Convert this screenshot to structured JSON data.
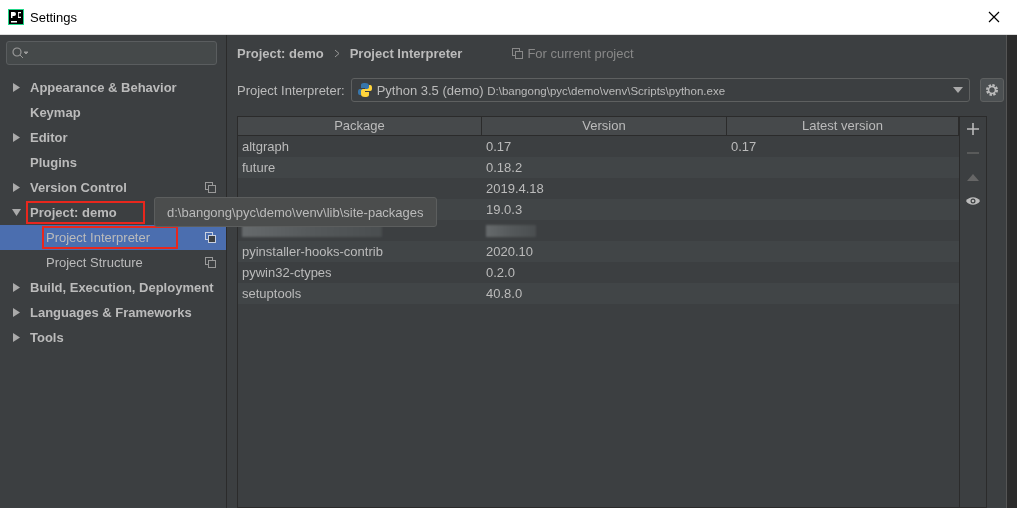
{
  "window": {
    "title": "Settings"
  },
  "sidebar": {
    "items": [
      {
        "label": "Appearance & Behavior",
        "kind": "group",
        "expanded": false,
        "project_scoped": false,
        "annotated": false
      },
      {
        "label": "Keymap",
        "kind": "leaf",
        "project_scoped": false,
        "annotated": false
      },
      {
        "label": "Editor",
        "kind": "group",
        "expanded": false,
        "project_scoped": false,
        "annotated": false
      },
      {
        "label": "Plugins",
        "kind": "leaf",
        "project_scoped": false,
        "annotated": false
      },
      {
        "label": "Version Control",
        "kind": "group",
        "expanded": false,
        "project_scoped": true,
        "annotated": false
      },
      {
        "label": "Project: demo",
        "kind": "group",
        "expanded": true,
        "project_scoped": false,
        "annotated": true,
        "children": [
          {
            "label": "Project Interpreter",
            "selected": true,
            "project_scoped": true,
            "annotated": true
          },
          {
            "label": "Project Structure",
            "selected": false,
            "project_scoped": true,
            "annotated": false
          }
        ]
      },
      {
        "label": "Build, Execution, Deployment",
        "kind": "group",
        "expanded": false,
        "project_scoped": false,
        "annotated": false
      },
      {
        "label": "Languages & Frameworks",
        "kind": "group",
        "expanded": false,
        "project_scoped": false,
        "annotated": false
      },
      {
        "label": "Tools",
        "kind": "group",
        "expanded": false,
        "project_scoped": false,
        "annotated": false
      }
    ]
  },
  "breadcrumb": [
    "Project: demo",
    "Project Interpreter"
  ],
  "scope_note": "For current project",
  "interpreter": {
    "label": "Project Interpreter:",
    "name": "Python 3.5 (demo)",
    "path": "D:\\bangong\\pyc\\demo\\venv\\Scripts\\python.exe"
  },
  "table": {
    "columns": [
      "Package",
      "Version",
      "Latest version"
    ],
    "rows": [
      {
        "kind": "plain",
        "cells": [
          "altgraph",
          "0.17",
          "0.17"
        ]
      },
      {
        "kind": "plain",
        "cells": [
          "future",
          "0.18.2",
          ""
        ]
      },
      {
        "kind": "plain",
        "cells": [
          "",
          "2019.4.18",
          ""
        ]
      },
      {
        "kind": "plain",
        "cells": [
          "",
          "19.0.3",
          ""
        ]
      },
      {
        "kind": "blurred",
        "cells": [
          "",
          "",
          ""
        ]
      },
      {
        "kind": "plain",
        "cells": [
          "pyinstaller-hooks-contrib",
          "2020.10",
          ""
        ]
      },
      {
        "kind": "plain",
        "cells": [
          "pywin32-ctypes",
          "0.2.0",
          ""
        ]
      },
      {
        "kind": "plain",
        "cells": [
          "setuptools",
          "40.8.0",
          ""
        ]
      }
    ]
  },
  "tooltip": "d:\\bangong\\pyc\\demo\\venv\\lib\\site-packages"
}
